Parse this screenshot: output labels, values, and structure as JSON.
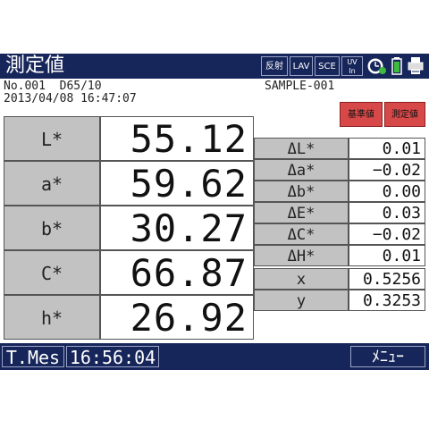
{
  "titlebar": {
    "title": "測定値",
    "buttons": [
      {
        "label": "反射"
      },
      {
        "label": "LAV"
      },
      {
        "label": "SCE"
      },
      {
        "label": "UV\nIn"
      }
    ]
  },
  "info": {
    "sample_no": "No.001",
    "illuminant": "D65/10",
    "datetime": "2013/04/08 16:47:07",
    "sample_name": "SAMPLE-001"
  },
  "buttons": {
    "reference": "基準値",
    "measured": "測定値"
  },
  "left_table": [
    {
      "key": "L*",
      "value": "55.12"
    },
    {
      "key": "a*",
      "value": "59.62"
    },
    {
      "key": "b*",
      "value": "30.27"
    },
    {
      "key": "C*",
      "value": "66.87"
    },
    {
      "key": "h*",
      "value": "26.92"
    }
  ],
  "right_table": [
    {
      "key": "ΔL*",
      "value": "0.01"
    },
    {
      "key": "Δa*",
      "value": "−0.02"
    },
    {
      "key": "Δb*",
      "value": "0.00"
    },
    {
      "key": "ΔE*",
      "value": "0.03"
    },
    {
      "key": "ΔC*",
      "value": "−0.02"
    },
    {
      "key": "ΔH*",
      "value": "0.01"
    },
    {
      "key": "x",
      "value": "0.5256"
    },
    {
      "key": "y",
      "value": "0.3253"
    }
  ],
  "bottombar": {
    "mode": "T.Mes",
    "time": "16:56:04",
    "menu": "ﾒﾆｭｰ"
  },
  "colors": {
    "bar": "#17265a",
    "key_cell": "#c2c2c2",
    "red_button": "#d74848"
  },
  "icons": [
    "globe-clock-icon",
    "battery-icon",
    "printer-icon"
  ]
}
